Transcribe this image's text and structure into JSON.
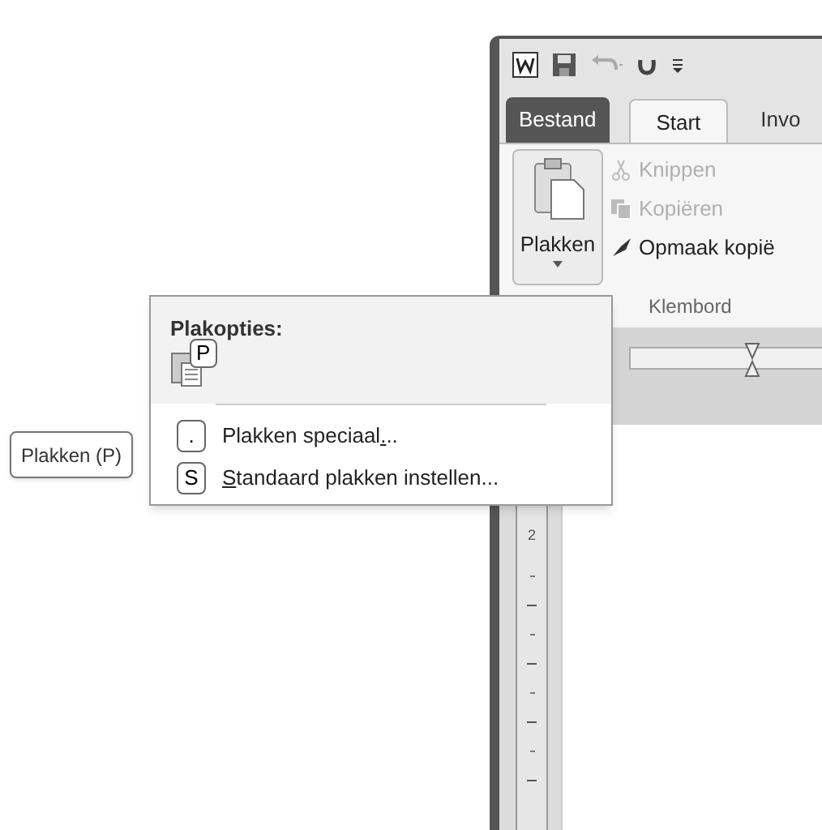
{
  "window": {
    "tabs": [
      {
        "label": "Bestand",
        "kind": "file",
        "selected": false
      },
      {
        "label": "Start",
        "kind": "tab",
        "selected": true
      },
      {
        "label": "Invo",
        "kind": "tab",
        "selected": false
      }
    ],
    "ribbon": {
      "paste_button": {
        "label": "Plakken"
      },
      "small_buttons": [
        {
          "label": "Knippen",
          "disabled": true
        },
        {
          "label": "Kopiëren",
          "disabled": true
        },
        {
          "label": "Opmaak kopië",
          "disabled": false
        }
      ],
      "group_label": "Klembord"
    },
    "vertical_ruler": {
      "label": "2"
    }
  },
  "paste_menu": {
    "heading": "Plakopties:",
    "option_keytip": "P",
    "items": [
      {
        "before": "Plakken speciaal",
        "mnemonic": ".",
        "after": "..",
        "keytip": "."
      },
      {
        "mnemonic": "S",
        "after": "tandaard plakken instellen...",
        "keytip": "S"
      }
    ]
  },
  "tooltip": "Plakken (P)"
}
